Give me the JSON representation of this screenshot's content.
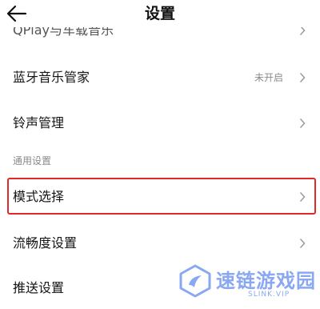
{
  "header": {
    "title": "设置"
  },
  "rows": [
    {
      "label": "QPlay与车载音乐",
      "value": ""
    },
    {
      "label": "蓝牙音乐管家",
      "value": "未开启"
    },
    {
      "label": "铃声管理",
      "value": ""
    }
  ],
  "section": {
    "label": "通用设置"
  },
  "general_rows": [
    {
      "label": "模式选择",
      "value": ""
    },
    {
      "label": "流畅度设置",
      "value": ""
    },
    {
      "label": "推送设置",
      "value": ""
    }
  ],
  "watermark": {
    "name": "速链游戏园",
    "url": "SLINK.VIP"
  },
  "colors": {
    "highlight": "#e02a2a",
    "secondary_text": "#8a8a8a",
    "watermark": "#8aa8f2"
  }
}
